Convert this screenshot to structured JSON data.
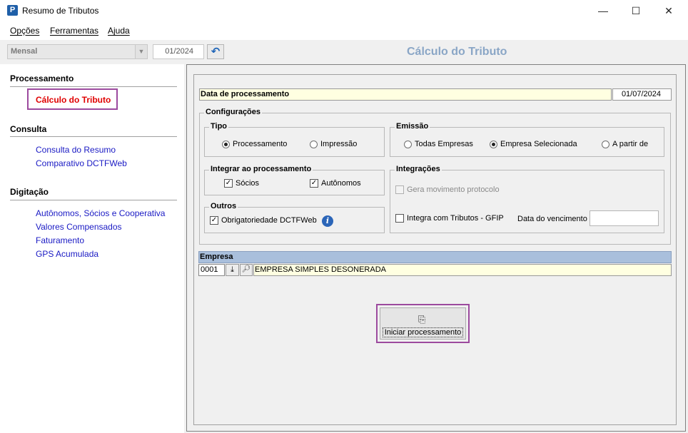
{
  "window": {
    "title": "Resumo de Tributos",
    "icon_letter": "P"
  },
  "menu": [
    "Opções",
    "Ferramentas",
    "Ajuda"
  ],
  "toolbar": {
    "periodicity": "Mensal",
    "period": "01/2024"
  },
  "page_title": "Cálculo do Tributo",
  "sidebar": {
    "sections": [
      {
        "title": "Processamento",
        "items": [
          "Cálculo do Tributo"
        ]
      },
      {
        "title": "Consulta",
        "items": [
          "Consulta do Resumo",
          "Comparativo DCTFWeb"
        ]
      },
      {
        "title": "Digitação",
        "items": [
          "Autônomos, Sócios e Cooperativa",
          "Valores Compensados",
          "Faturamento",
          "GPS Acumulada"
        ]
      }
    ],
    "active_item": "Cálculo do Tributo"
  },
  "form": {
    "date_label": "Data de processamento",
    "date_value": "01/07/2024",
    "config_title": "Configurações",
    "tipo": {
      "title": "Tipo",
      "options": [
        "Processamento",
        "Impressão"
      ],
      "selected": "Processamento"
    },
    "emissao": {
      "title": "Emissão",
      "options": [
        "Todas Empresas",
        "Empresa Selecionada",
        "A partir de"
      ],
      "selected": "Empresa Selecionada"
    },
    "integrar": {
      "title": "Integrar ao processamento",
      "options": [
        {
          "label": "Sócios",
          "checked": true
        },
        {
          "label": "Autônomos",
          "checked": true
        }
      ]
    },
    "outros": {
      "title": "Outros",
      "option": {
        "label": "Obrigatoriedade DCTFWeb",
        "checked": true
      }
    },
    "integracoes": {
      "title": "Integrações",
      "gera": {
        "label": "Gera movimento protocolo",
        "checked": false,
        "disabled": true
      },
      "integra": {
        "label": "Integra com Tributos - GFIP",
        "checked": false
      },
      "vencimento_label": "Data do vencimento",
      "vencimento_value": ""
    },
    "empresa": {
      "title": "Empresa",
      "code": "0001",
      "name": "EMPRESA SIMPLES DESONERADA"
    },
    "start_button": "Iniciar processamento"
  }
}
